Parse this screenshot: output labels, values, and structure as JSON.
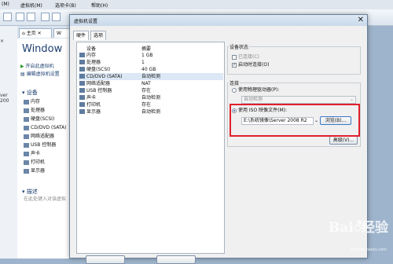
{
  "app": {
    "menu": [
      "(M)",
      "虚拟机(M)",
      "选项卡(B)",
      "帮助(H)"
    ],
    "tabs": [
      "主页",
      "W"
    ],
    "vm_title": "Window",
    "vm_actions": [
      "开启此虚拟机",
      "编辑虚拟机设置"
    ],
    "devices_header": "设备",
    "devices": [
      "内存",
      "处理器",
      "硬盘(SCSI)",
      "CD/DVD (SATA)",
      "网络适配器",
      "USB 控制器",
      "声卡",
      "打印机",
      "显示器"
    ],
    "description_header": "描述",
    "description_placeholder": "在此处键入对该虚拟",
    "left_cut_texts": [
      "ver 200"
    ]
  },
  "dialog": {
    "title": "虚拟机设置",
    "close": "✕",
    "tabs": [
      "硬件",
      "选项"
    ],
    "table": {
      "columns": [
        "设备",
        "摘要"
      ],
      "rows": [
        {
          "device": "内存",
          "summary": "1 GB"
        },
        {
          "device": "处理器",
          "summary": "1"
        },
        {
          "device": "硬盘(SCSI)",
          "summary": "40 GB"
        },
        {
          "device": "CD/DVD (SATA)",
          "summary": "自动检测"
        },
        {
          "device": "网络适配器",
          "summary": "NAT"
        },
        {
          "device": "USB 控制器",
          "summary": "存在"
        },
        {
          "device": "声卡",
          "summary": "自动检测"
        },
        {
          "device": "打印机",
          "summary": "存在"
        },
        {
          "device": "显示器",
          "summary": "自动检测"
        }
      ],
      "selected_index": 3
    },
    "device_status": {
      "label": "设备状态",
      "connected": "已连接(C)",
      "connect_on_power": "启动时连接(O)"
    },
    "connection": {
      "label": "连接",
      "physical_drive": "使用物理驱动器(P):",
      "physical_drive_value": "自动检测",
      "iso": "使用 ISO 映像文件(M):",
      "iso_path": "E:\\系统镜像\\Server 2008 R2",
      "browse": "浏览(B)...",
      "advanced": "高级(V)..."
    }
  },
  "watermark": {
    "text": "Baiꦶ经验",
    "sub": "jingyan.baidu.com"
  },
  "colors": {
    "highlight": "#e0202a",
    "accent": "#1d3f72"
  }
}
